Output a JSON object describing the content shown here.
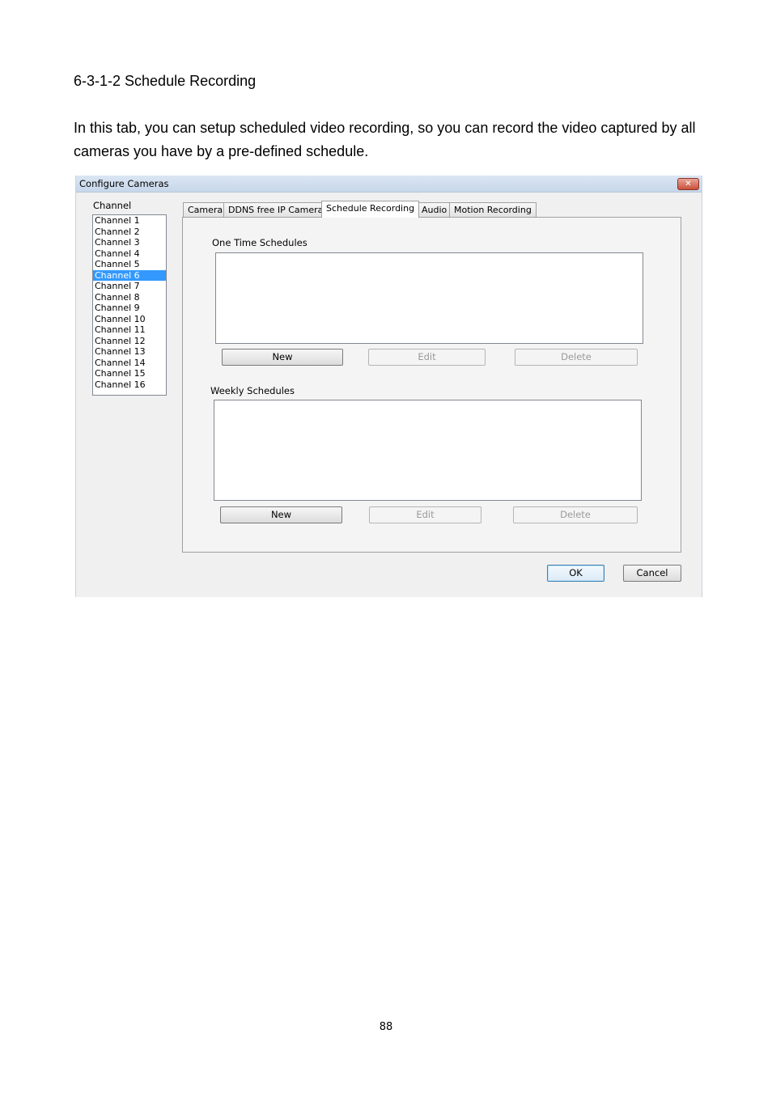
{
  "document": {
    "heading": "6-3-1-2 Schedule Recording",
    "paragraph": "In this tab, you can setup scheduled video recording, so you can record the video captured by all cameras you have by a pre-defined schedule.",
    "page_number": "88"
  },
  "dialog": {
    "title": "Configure Cameras",
    "close_glyph": "✕",
    "channel_label": "Channel",
    "channels": [
      "Channel 1",
      "Channel 2",
      "Channel 3",
      "Channel 4",
      "Channel 5",
      "Channel 6",
      "Channel 7",
      "Channel 8",
      "Channel 9",
      "Channel 10",
      "Channel 11",
      "Channel 12",
      "Channel 13",
      "Channel 14",
      "Channel 15",
      "Channel 16"
    ],
    "selected_channel": "Channel 6",
    "tabs": [
      "Camera",
      "DDNS free IP Camera",
      "Schedule Recording",
      "Audio",
      "Motion Recording"
    ],
    "active_tab": "Schedule Recording",
    "one_time": {
      "label": "One Time Schedules",
      "new": "New",
      "edit": "Edit",
      "delete": "Delete"
    },
    "weekly": {
      "label": "Weekly Schedules",
      "new": "New",
      "edit": "Edit",
      "delete": "Delete"
    },
    "ok": "OK",
    "cancel": "Cancel"
  }
}
